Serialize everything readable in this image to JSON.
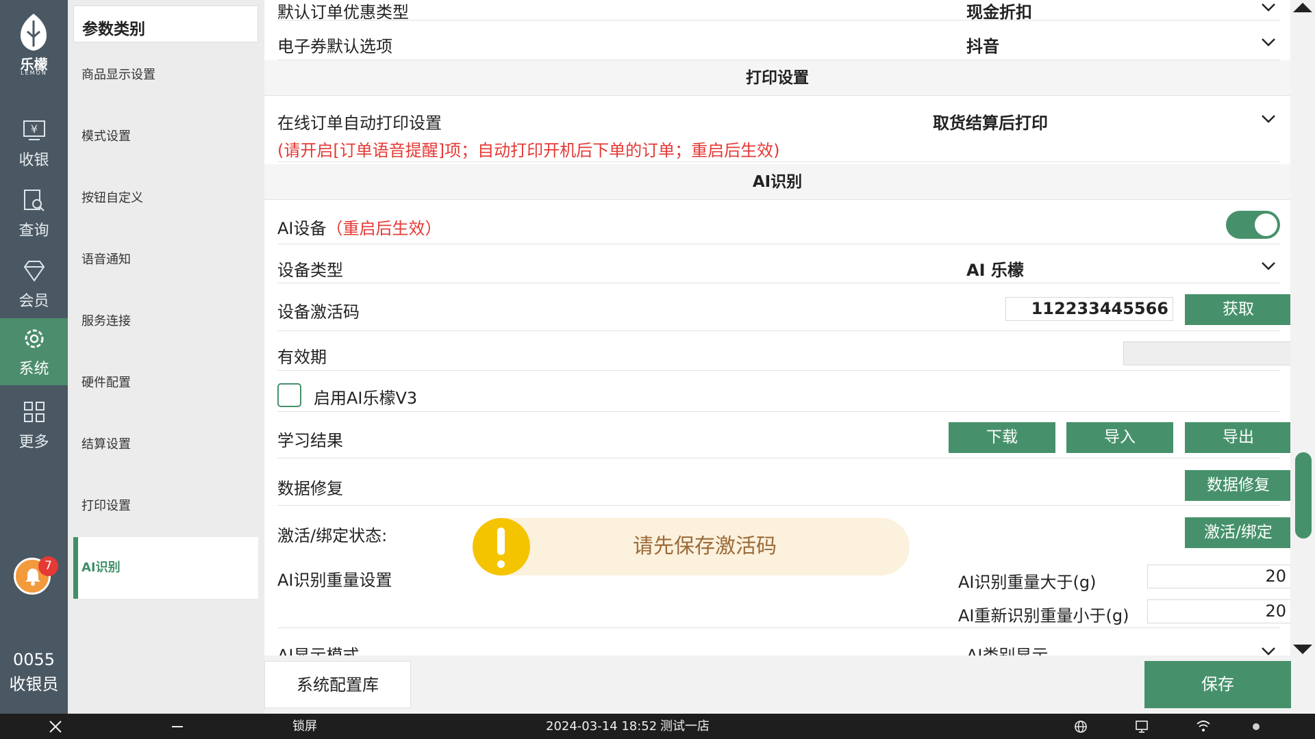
{
  "app": {
    "logo_text": "乐檬",
    "logo_sub": "LEMON"
  },
  "rail": {
    "items": [
      {
        "label": "收银",
        "icon": "cashier-icon"
      },
      {
        "label": "查询",
        "icon": "query-icon"
      },
      {
        "label": "会员",
        "icon": "member-icon"
      },
      {
        "label": "系统",
        "icon": "settings-icon",
        "active": true
      },
      {
        "label": "更多",
        "icon": "grid-icon"
      }
    ],
    "notification_count": "7",
    "user_code": "0055",
    "user_role": "收银员"
  },
  "categories": {
    "header": "参数类别",
    "items": [
      "商品显示设置",
      "模式设置",
      "按钮自定义",
      "语音通知",
      "服务连接",
      "硬件配置",
      "结算设置",
      "打印设置",
      "AI识别"
    ],
    "active": "AI识别"
  },
  "settings": {
    "top_partial_label": "默认订单优惠类型",
    "top_partial_value": "现金折扣",
    "ecoupon_label": "电子券默认选项",
    "ecoupon_value": "抖音",
    "print_section": "打印设置",
    "online_print_label": "在线订单自动打印设置",
    "online_print_value": "取货结算后打印",
    "online_print_note": "(请开启[订单语音提醒]项；自动打印开机后下单的订单；重启后生效)",
    "ai_section": "AI识别",
    "ai_device_label": "AI设备",
    "ai_device_note": "（重启后生效）",
    "ai_device_enabled": true,
    "device_type_label": "设备类型",
    "device_type_value": "AI 乐檬",
    "activation_label": "设备激活码",
    "activation_value": "112233445566",
    "fetch_button": "获取",
    "validity_label": "有效期",
    "validity_value": "",
    "enable_v3_label": "启用AI乐檬V3",
    "enable_v3_checked": false,
    "learning_label": "学习结果",
    "download_button": "下载",
    "import_button": "导入",
    "export_button": "导出",
    "repair_label": "数据修复",
    "repair_button": "数据修复",
    "bind_status_label": "激活/绑定状态:",
    "bind_button": "激活/绑定",
    "weight_label": "AI识别重量设置",
    "weight_gt_label": "AI识别重量大于(g)",
    "weight_gt_value": "20",
    "reweight_lt_label": "AI重新识别重量小于(g)",
    "reweight_lt_value": "20",
    "display_mode_label": "AI显示模式",
    "display_mode_value": "AI类别显示"
  },
  "toast": {
    "message": "请先保存激活码"
  },
  "footer": {
    "config_button": "系统配置库",
    "save_button": "保存"
  },
  "taskbar": {
    "lock_label": "锁屏",
    "datetime": "2024-03-14 18:52",
    "store": "测试一店"
  },
  "colors": {
    "accent": "#46916b",
    "rail": "#4a5863",
    "warning": "#e53935",
    "toast_bg": "#fbf1dc",
    "toast_icon": "#f5c400"
  }
}
